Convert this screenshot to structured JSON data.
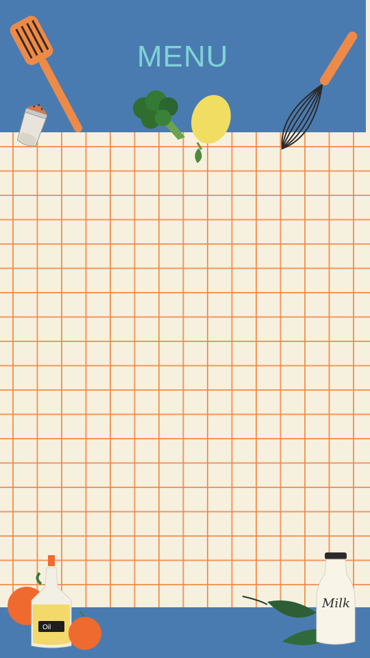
{
  "menu": {
    "title": "MENU"
  },
  "colors": {
    "band_blue": "#4a7bb0",
    "paper": "#f6f0df",
    "grid_orange": "#f08746",
    "title_teal": "#7fd3d6",
    "spatula_orange": "#ee8a48",
    "broccoli_green": "#2f6e2f",
    "lemon_yellow": "#f1dd62",
    "orange_fruit": "#ef6a2e",
    "oil_yellow": "#f3d96a",
    "leaf_green": "#2d5e35"
  },
  "labels": {
    "oil": "Oil",
    "milk": "Milk"
  },
  "icons": [
    "spatula-icon",
    "salt-shaker-icon",
    "broccoli-icon",
    "lemon-icon",
    "whisk-icon",
    "orange-icon",
    "oil-bottle-icon",
    "leaves-icon",
    "milk-bottle-icon"
  ]
}
